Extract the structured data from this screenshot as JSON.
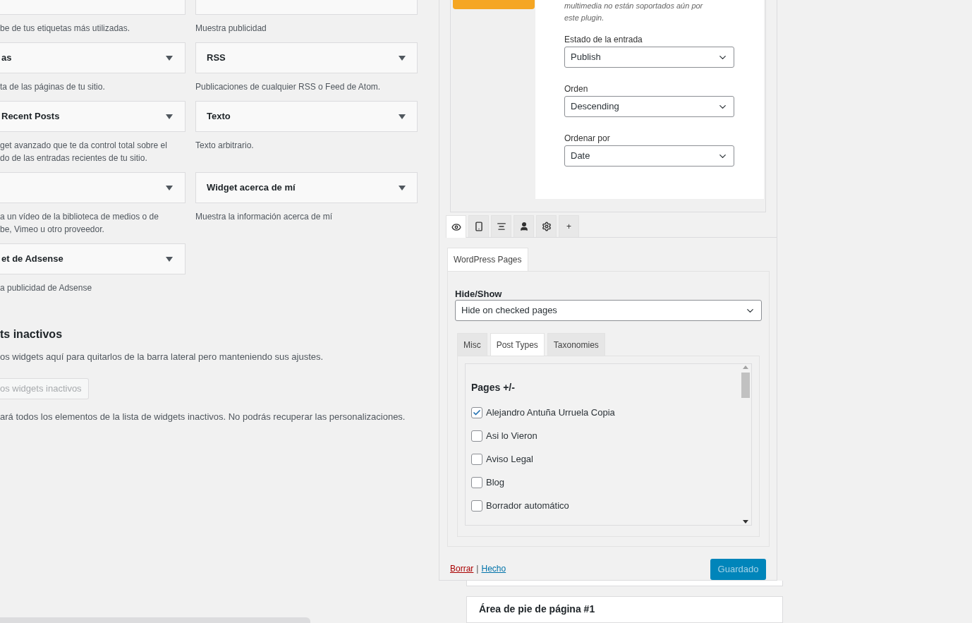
{
  "widgets": {
    "rows": [
      {
        "left": {
          "description": [
            "be de tus etiquetas más utilizadas."
          ],
          "top_cut": true
        },
        "right": {
          "description": [
            "Muestra publicidad"
          ],
          "top_cut": true
        }
      },
      {
        "left": {
          "title": "as",
          "description": [
            "ta de las páginas de tu sitio."
          ]
        },
        "right": {
          "title": "RSS",
          "description": [
            "Publicaciones de cualquier RSS o Feed de Atom."
          ]
        }
      },
      {
        "left": {
          "title": "Recent Posts",
          "description": [
            "get avanzado que te da control total sobre el",
            "do de las entradas recientes de tu sitio."
          ]
        },
        "right": {
          "title": "Texto",
          "description": [
            "Texto arbitrario."
          ]
        }
      },
      {
        "left": {
          "description": [
            "a un vídeo de la biblioteca de medios o de",
            "be, Vimeo u otro proveedor."
          ]
        },
        "right": {
          "title": "Widget acerca de mí",
          "description": [
            "Muestra la información acerca de mí"
          ]
        }
      },
      {
        "left": {
          "title": "et de Adsense",
          "description": [
            "a publicidad de Adsense"
          ]
        }
      }
    ]
  },
  "inactive": {
    "heading": "ts inactivos",
    "description": "os widgets aquí para quitarlos de la barra lateral pero manteniendo sus ajustes.",
    "clear_button": "os widgets inactivos",
    "note": "ará todos los elementos de la lista de widgets inactivos. No podrás recuperar las personalizaciones."
  },
  "widget_settings": {
    "note_lines": [
      "multimedia no están soportados aún por",
      "este plugin."
    ],
    "fields": [
      {
        "label": "Estado de la entrada",
        "value": "Publish"
      },
      {
        "label": "Orden",
        "value": "Descending"
      },
      {
        "label": "Ordenar por",
        "value": "Date"
      }
    ]
  },
  "visibility": {
    "icon_tabs": [
      {
        "kind": "eye",
        "selected": true
      },
      {
        "kind": "mobile",
        "selected": false
      },
      {
        "kind": "align",
        "selected": false
      },
      {
        "kind": "user",
        "selected": false
      },
      {
        "kind": "gear",
        "selected": false
      },
      {
        "kind": "text",
        "label": "+",
        "selected": false
      }
    ],
    "section_tab": {
      "label": "WordPress Pages",
      "selected": true
    },
    "hide_show": {
      "label": "Hide/Show",
      "value": "Hide on checked pages"
    },
    "tabs": [
      {
        "label": "Misc",
        "selected": false
      },
      {
        "label": "Post Types",
        "selected": true
      },
      {
        "label": "Taxonomies",
        "selected": false
      }
    ],
    "list": {
      "heading": "Pages +/-",
      "items": [
        {
          "label": "Alejandro Antuña Urruela Copia",
          "checked": true
        },
        {
          "label": "Asi lo Vieron",
          "checked": false
        },
        {
          "label": "Aviso Legal",
          "checked": false
        },
        {
          "label": "Blog",
          "checked": false
        },
        {
          "label": "Borrador automático",
          "checked": false
        }
      ]
    }
  },
  "footer": {
    "delete_link": "Borrar",
    "separator": "|",
    "done_link": "Hecho",
    "save_button": "Guardado"
  },
  "footer_area": {
    "title": "Área de pie de página #1"
  }
}
